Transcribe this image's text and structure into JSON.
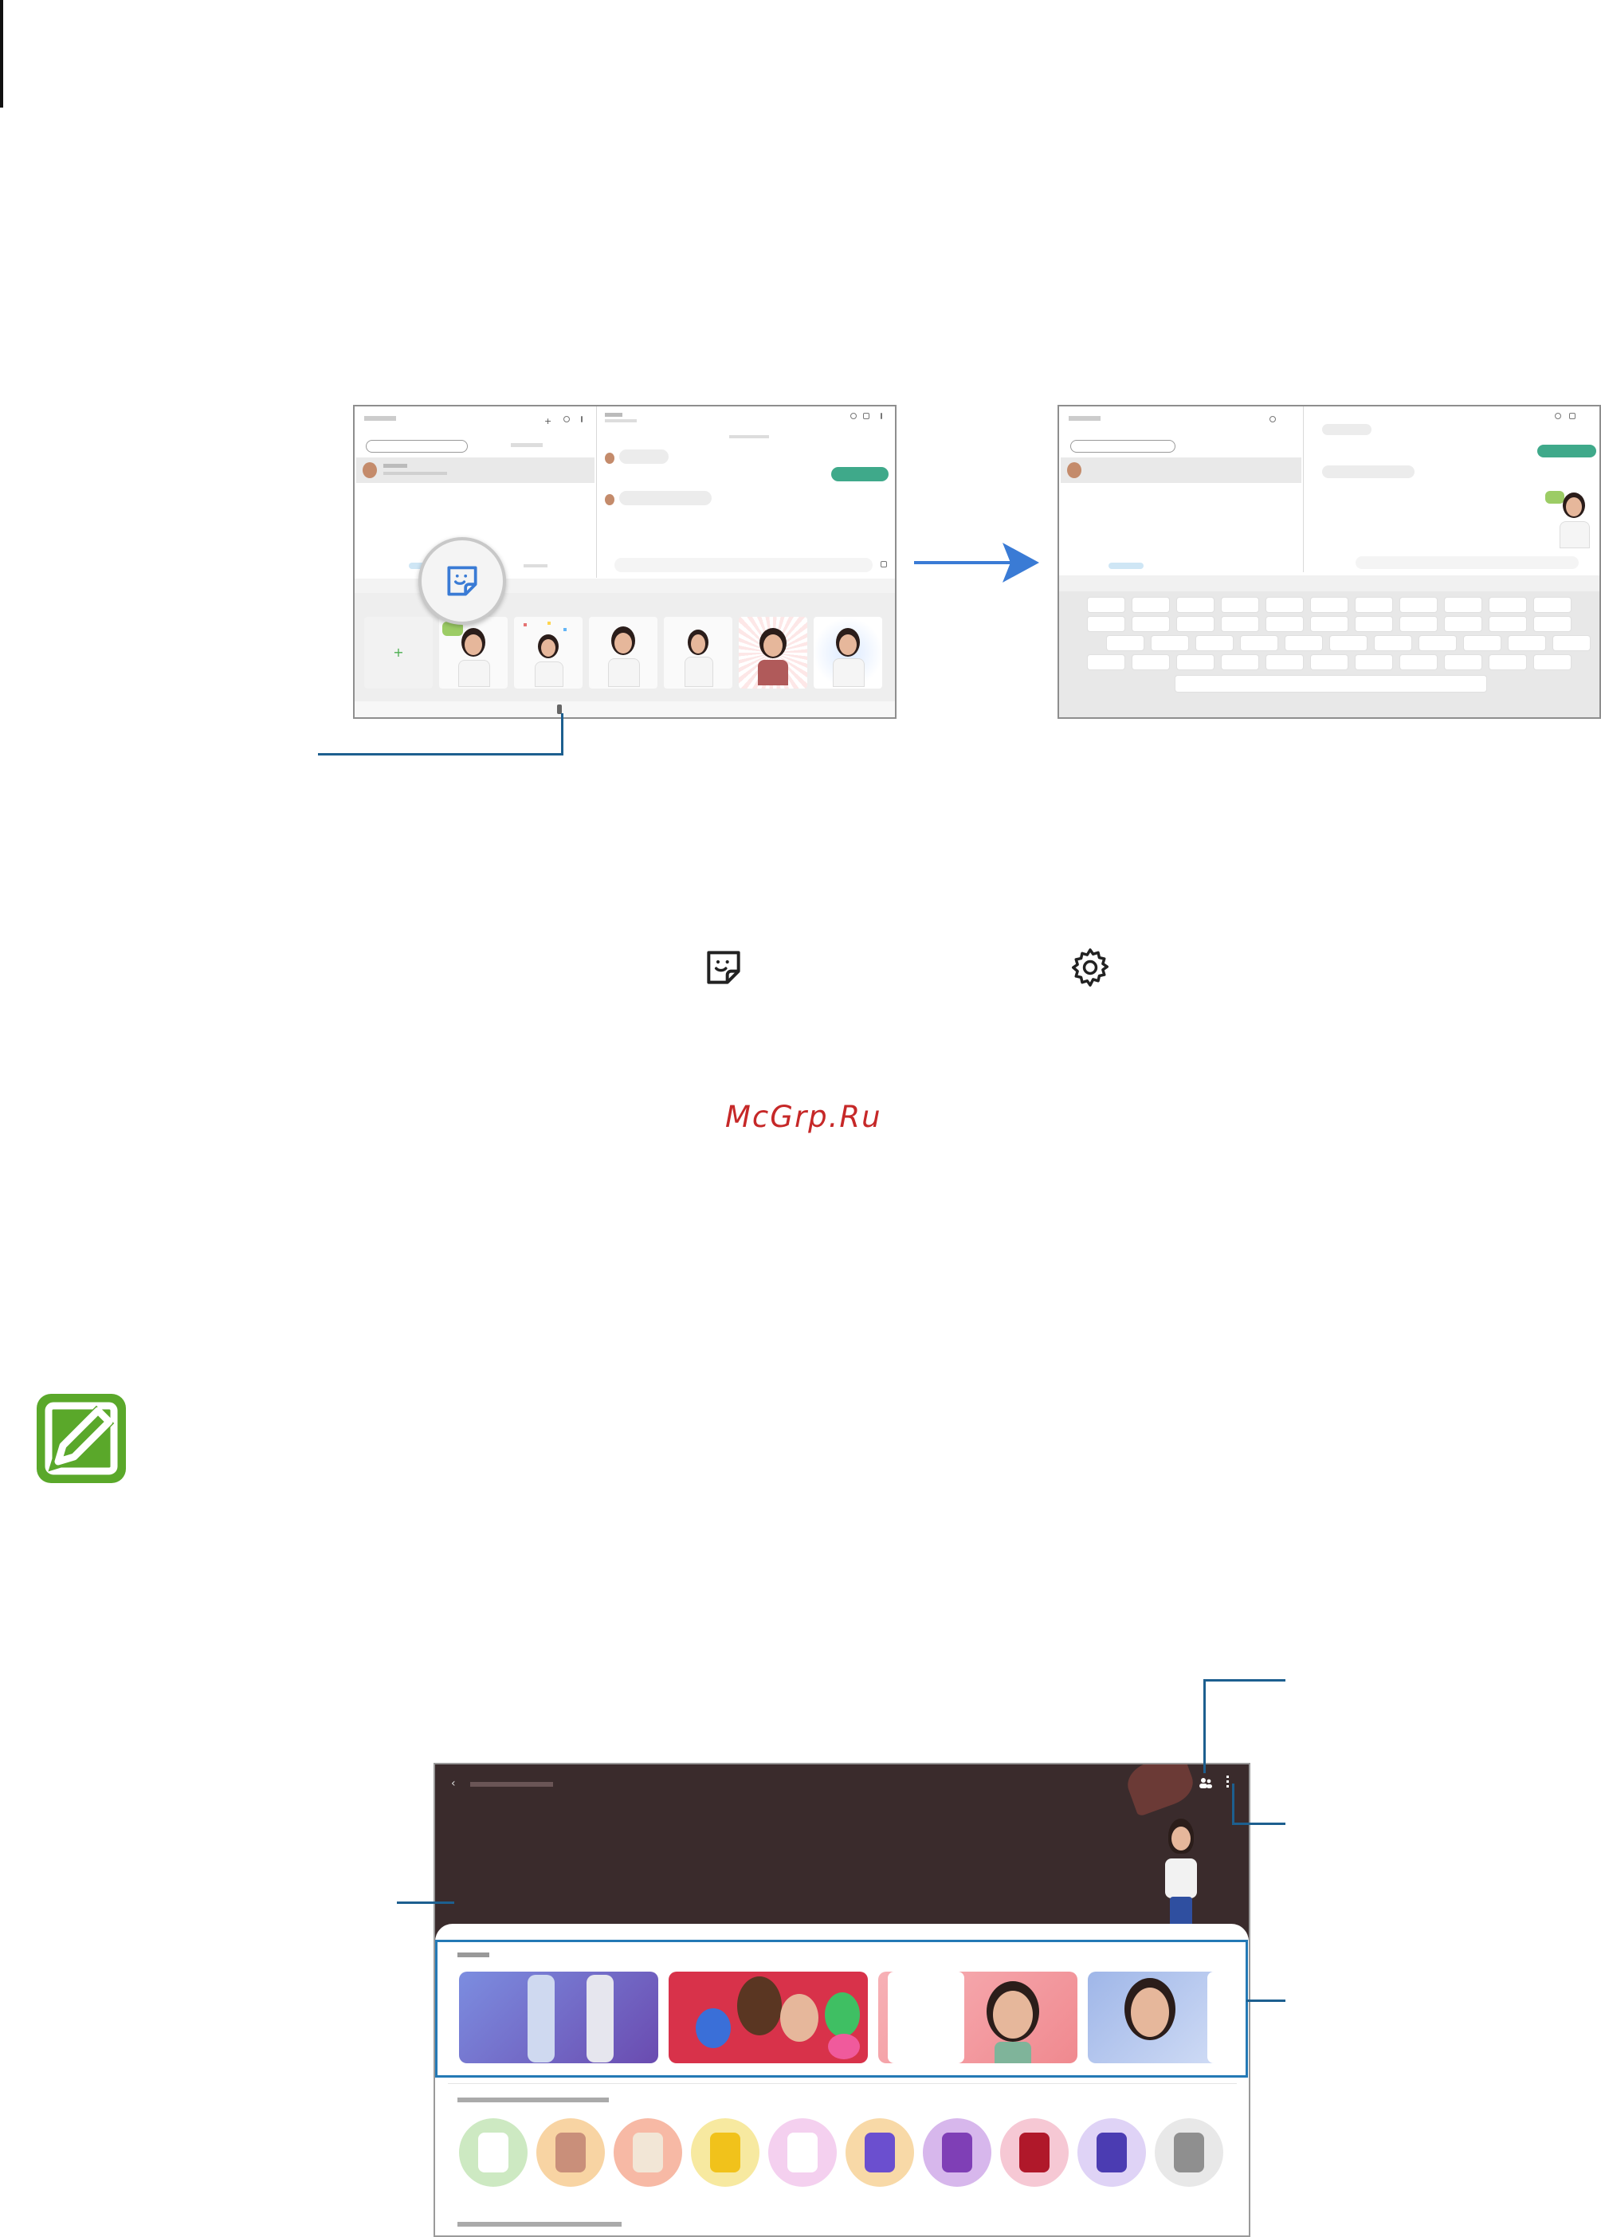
{
  "watermark": "McGrp.Ru",
  "icons": {
    "sticker": "sticker-icon",
    "settings": "gear-icon",
    "note": "note-pen-icon"
  },
  "colors": {
    "accent_blue": "#3a7bd5",
    "callout_blue": "#1d5f8f",
    "note_green": "#5aa82a",
    "watermark_red": "#c62828",
    "studio_bg": "#3a2b2c"
  }
}
